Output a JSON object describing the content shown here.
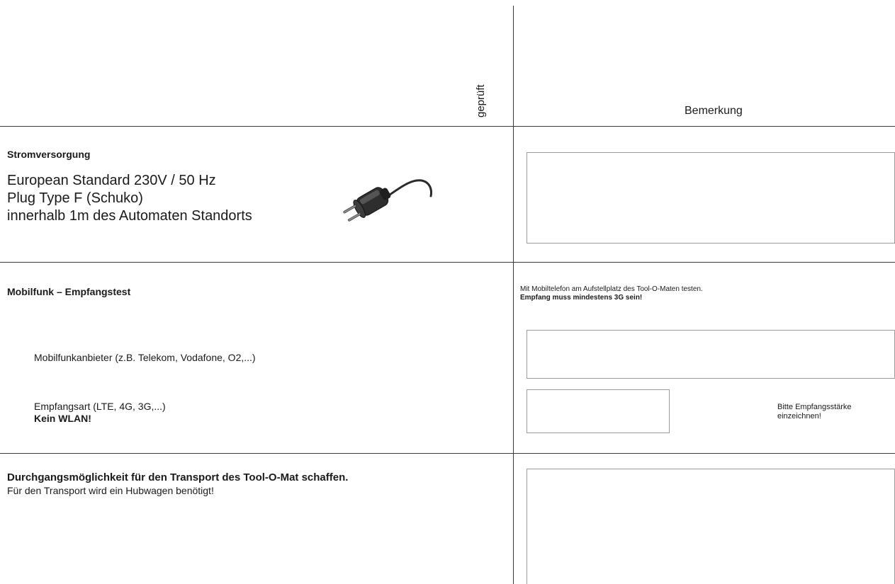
{
  "header": {
    "geprueft_label": "geprüft",
    "bemerkung_label": "Bemerkung"
  },
  "power": {
    "heading": "Stromversorgung",
    "lines": [
      "European Standard 230V / 50 Hz",
      "Plug Type F (Schuko)",
      "innerhalb 1m des Automaten Standorts"
    ],
    "icon": "power-plug-icon"
  },
  "mobile": {
    "heading": "Mobilfunk – Empfangstest",
    "note_line1": "Mit Mobiltelefon am Aufstellplatz des Tool-O-Maten testen.",
    "note_line2": "Empfang muss mindestens 3G sein!",
    "provider_label": "Mobilfunkanbieter (z.B. Telekom, Vodafone, O2,...)",
    "type_label": "Empfangsart (LTE, 4G, 3G,...)",
    "type_note": "Kein WLAN!",
    "signal_hint_line1": "Bitte Empfangsstärke",
    "signal_hint_line2": "einzeichnen!"
  },
  "transport": {
    "heading": "Durchgangsmöglichkeit für den Transport des Tool-O-Mat schaffen.",
    "subtext": "Für den Transport wird ein Hubwagen benötigt!"
  }
}
